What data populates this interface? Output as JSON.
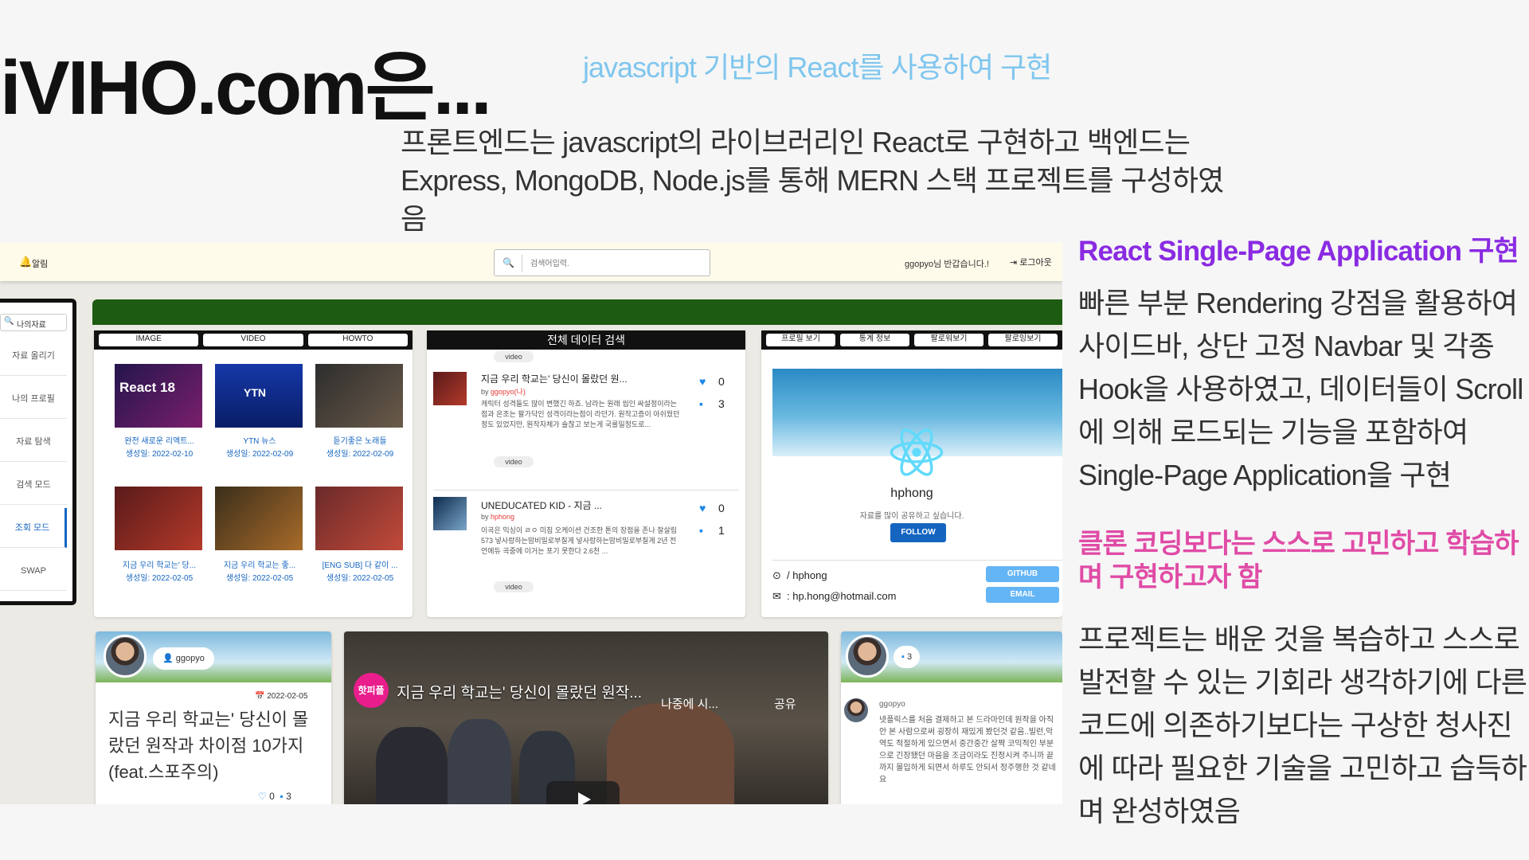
{
  "slide": {
    "title": "iVIHO.com은...",
    "subtitle": "javascript 기반의 React를 사용하여 구현",
    "intro": "프론트엔드는 javascript의 라이브러리인 React로 구현하고 백엔드는 Express, MongoDB, Node.js를 통해 MERN 스택 프로젝트를 구성하였음",
    "section1_heading": "React Single-Page Application 구현",
    "section1_body": "빠른 부분 Rendering 강점을 활용하여 사이드바, 상단 고정 Navbar 및 각종 Hook을 사용하였고, 데이터들이 Scroll에 의해 로드되는 기능을 포함하여 Single-Page Application을 구현",
    "section2_heading": "클론 코딩보다는 스스로 고민하고 학습하며 구현하고자 함",
    "section2_body": "프로젝트는 배운 것을 복습하고 스스로 발전할 수 있는 기회라 생각하기에 다른 코드에 의존하기보다는 구상한 청사진에 따라 필요한 기술을 고민하고 습득하며 완성하였음"
  },
  "app": {
    "topbar": {
      "bell_icon": "bell-icon",
      "bell_label": "알림",
      "search_placeholder": "검색어입력.",
      "greeting": "ggopyo님 반갑습니다.!",
      "logout_label": "로그아웃"
    },
    "sidebar": {
      "search_placeholder": "나의자료",
      "items": [
        {
          "label": "자료 올리기"
        },
        {
          "label": "나의 프로필"
        },
        {
          "label": "자료 탐색"
        },
        {
          "label": "검색 모드"
        },
        {
          "label": "조회 모드"
        },
        {
          "label": "SWAP"
        }
      ]
    },
    "panel_media": {
      "tabs": [
        "IMAGE",
        "VIDEO",
        "HOWTO"
      ],
      "items": [
        {
          "title": "완전 새로운 리액트...",
          "date": "생성일: 2022-02-10",
          "thumb_text": "React 18"
        },
        {
          "title": "YTN 뉴스",
          "date": "생성일: 2022-02-09",
          "thumb_text": "YTN"
        },
        {
          "title": "듣기좋은 노래들",
          "date": "생성일: 2022-02-09",
          "thumb_text": ""
        },
        {
          "title": "지금 우리 학교는' 당...",
          "date": "생성일: 2022-02-05",
          "thumb_text": ""
        },
        {
          "title": "지금 우리 학교는 좋...",
          "date": "생성일: 2022-02-05",
          "thumb_text": ""
        },
        {
          "title": "[ENG SUB] 다 같이 ...",
          "date": "생성일: 2022-02-05",
          "thumb_text": ""
        }
      ]
    },
    "panel_search": {
      "title": "전체 데이터 검색",
      "top_tag": "video",
      "rows": [
        {
          "title": "지금 우리 학교는' 당신이 몰랐던 원...",
          "by_label": "by",
          "author": "ggopyo(나)",
          "desc": "캐릭터 성격들도 많이 변했긴 하죠. 남라는 원래 씹인 싸설정이라는 점과 온조는 팔가닥인 성격이라는점이 라던가. 원작고증이 아쉬웠던 정도 있었지만, 원작자체가 솔찮고 보는게 국룰일정도로...",
          "tag": "video",
          "likes": "0",
          "comments": "3"
        },
        {
          "title": "UNEDUCATED KID - 지금 ...",
          "by_label": "by",
          "author": "hphong",
          "desc": "이곡은 믹싱이 ㄹㅇ 미침 오케이션 건조한 톤의 장점을 존나 잘살림 573 넣사랑하는맘비밀로부칠게 넣사랑하는맘비밀로부칠게 2년 전 언에듀 곡중에 이거는 포기 못한다 2.6천 ...",
          "tag": "video",
          "likes": "0",
          "comments": "1"
        }
      ]
    },
    "panel_profile": {
      "tabs": [
        "프로필 보기",
        "통계 정보",
        "팔로워보기",
        "팔로잉보기"
      ],
      "name": "hphong",
      "subtitle": "자료를 많이 공유하고 싶습니다.",
      "follow_label": "FOLLOW",
      "github_text": "/ hphong",
      "email_text": ": hp.hong@hotmail.com",
      "github_button": "GITHUB",
      "email_button": "EMAIL"
    },
    "cards": {
      "card1": {
        "user": "ggopyo",
        "date": "2022-02-05",
        "title": "지금 우리 학교는' 당신이 몰랐던 원작과 차이점 10가지(feat.스포주의)",
        "likes": "0",
        "comments": "3"
      },
      "video": {
        "badge": "핫피플",
        "title": "지금 우리 학교는' 당신이 몰랐던 원작...",
        "watch_later": "나중에 시...",
        "share": "공유"
      },
      "card3": {
        "comment_count": "3",
        "comment_user": "ggopyo",
        "comment_text": "넷플릭스를 처음 결제하고 본 드라마인데 원작을 아직 안 본 사람으로써 굉장히 재밌게 봤던것 같음..빌런,악역도 적절하게 있으면서 중간중간 살짝 코믹적인 부분으로 긴장됐던 마음을 조금이라도 진정시켜 주니까 끝까지 몰입하게 되면서 하루도 안되서 정주행한 것 같네요"
      }
    }
  }
}
